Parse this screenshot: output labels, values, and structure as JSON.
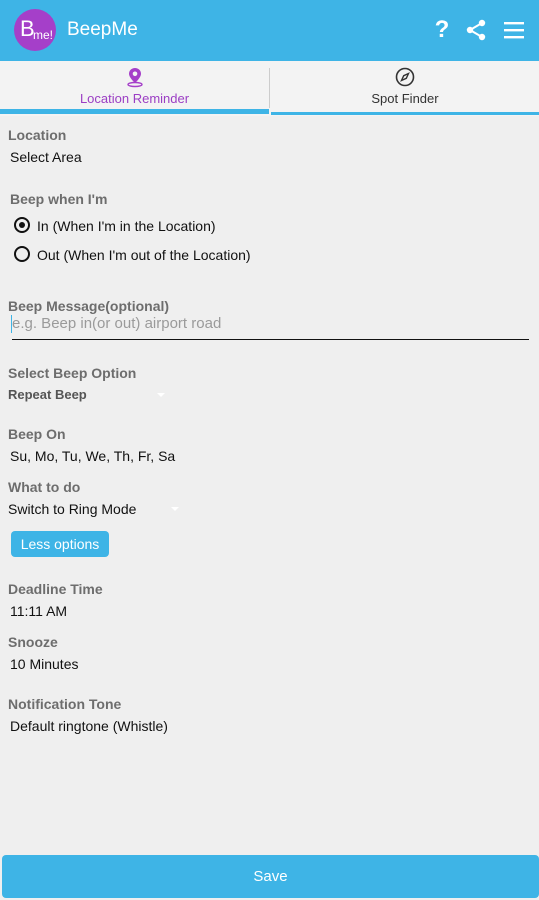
{
  "app": {
    "logo_big": "B",
    "logo_small": "me!",
    "title": "BeepMe",
    "help_glyph": "?",
    "brand_color": "#3eb4e6",
    "accent_purple": "#9b3ec4"
  },
  "icons": {
    "help": "help-icon",
    "share": "share-icon",
    "menu": "menu-icon",
    "location": "location-pin-icon",
    "compass": "compass-icon"
  },
  "tabs": [
    {
      "label": "Location Reminder",
      "active": true
    },
    {
      "label": "Spot Finder",
      "active": false
    }
  ],
  "form": {
    "location": {
      "label": "Location",
      "value": "Select Area"
    },
    "beep_when": {
      "label": "Beep when I'm",
      "options": [
        {
          "label": "In (When I'm in the Location)",
          "selected": true
        },
        {
          "label": "Out (When I'm out of the Location)",
          "selected": false
        }
      ]
    },
    "message": {
      "label": "Beep Message(optional)",
      "placeholder": "e.g. Beep in(or out) airport road",
      "value": ""
    },
    "beep_option": {
      "label": "Select Beep Option",
      "value": "Repeat Beep"
    },
    "beep_on": {
      "label": "Beep On",
      "value": "Su, Mo, Tu, We, Th, Fr, Sa"
    },
    "what_to_do": {
      "label": "What to do",
      "value": "Switch to Ring Mode"
    },
    "less_options": "Less options",
    "deadline": {
      "label": "Deadline Time",
      "value": "11:11 AM"
    },
    "snooze": {
      "label": "Snooze",
      "value": "10 Minutes"
    },
    "tone": {
      "label": "Notification Tone",
      "value": "Default ringtone (Whistle)"
    }
  },
  "save_label": "Save"
}
